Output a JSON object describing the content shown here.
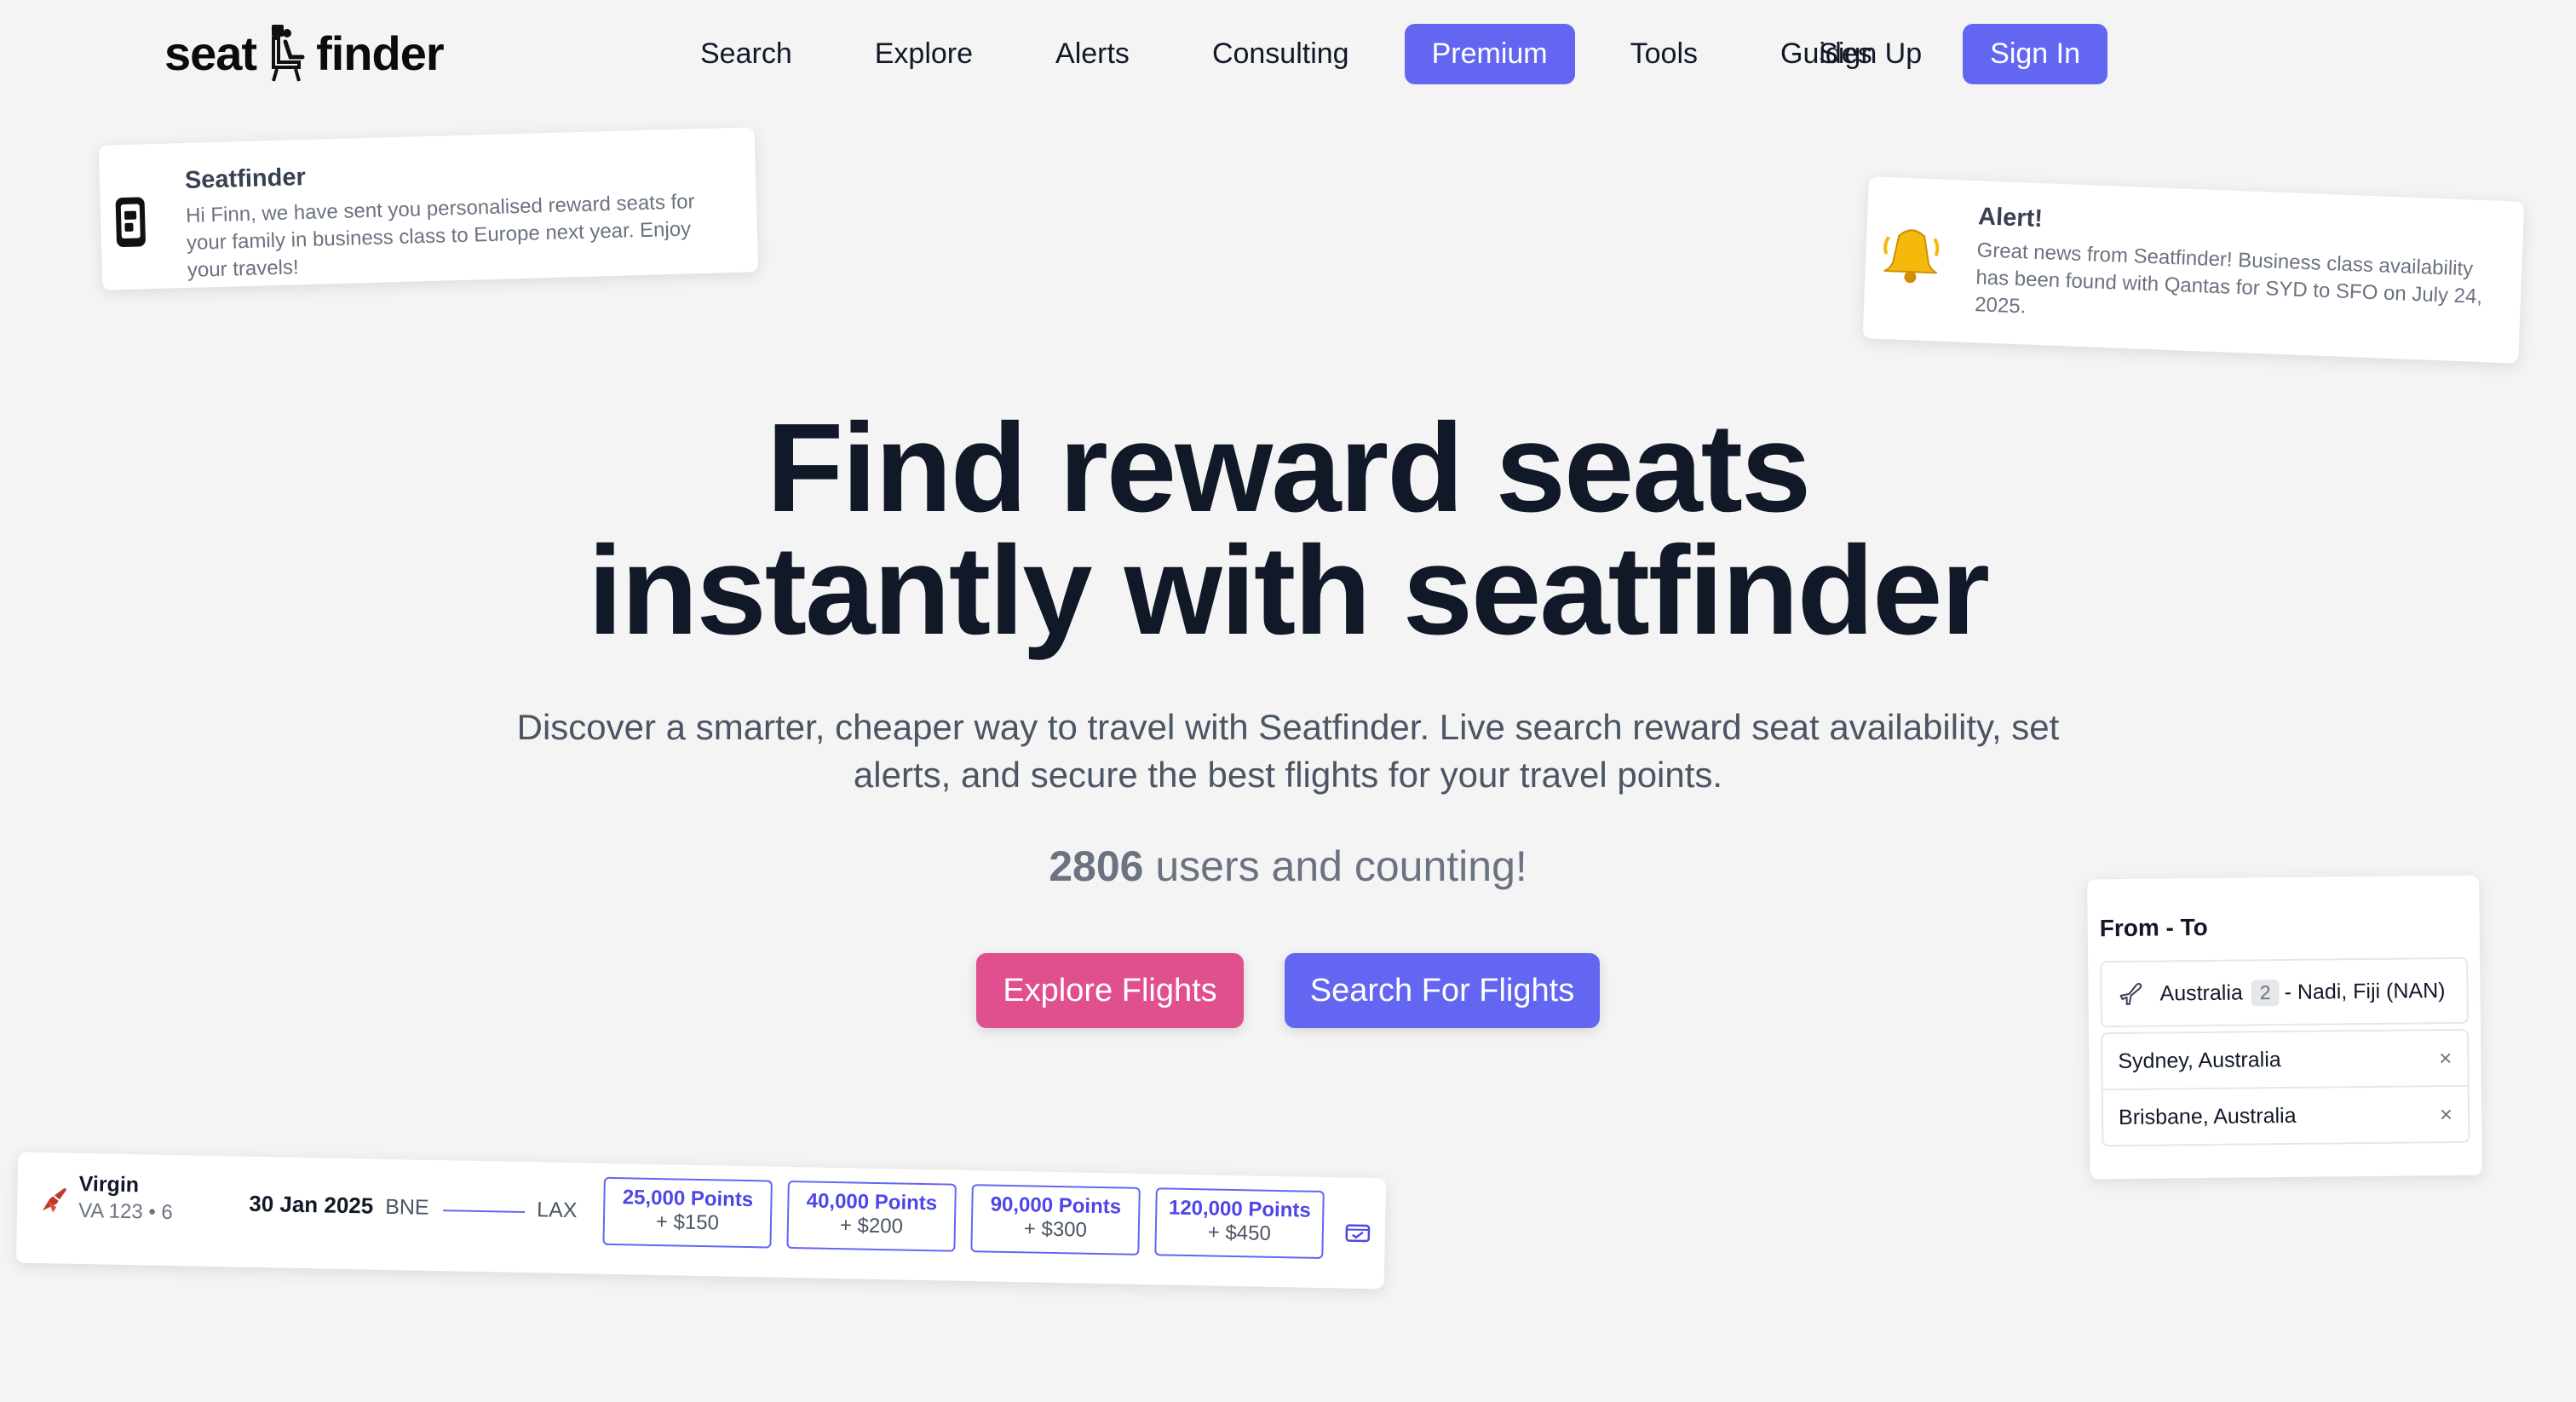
{
  "brand": {
    "name_left": "seat",
    "name_right": "finder"
  },
  "nav": {
    "links": [
      "Search",
      "Explore",
      "Alerts",
      "Consulting",
      "Premium",
      "Tools",
      "Guides"
    ],
    "signup": "Sign Up",
    "signin": "Sign In"
  },
  "notifications": [
    {
      "title": "Seatfinder",
      "message": "Hi Finn, we have sent you personalised reward seats for your family in business class to Europe next year. Enjoy your travels!"
    },
    {
      "title": "Alert!",
      "message": "Great news from Seatfinder! Business class availability has been found with Qantas for SYD to SFO on July 24, 2025."
    }
  ],
  "hero": {
    "title_line1": "Find reward seats",
    "title_line2": "instantly with seatfinder",
    "subtitle": "Discover a smarter, cheaper way to travel with Seatfinder. Live search reward seat availability, set alerts, and secure the best flights for your travel points.",
    "user_count": "2806",
    "user_count_suffix": " users and counting!",
    "explore_button": "Explore Flights",
    "search_button": "Search For Flights"
  },
  "route_picker": {
    "label": "From - To",
    "origin": "Australia",
    "origin_count": "2",
    "destination": "- Nadi, Fiji (NAN)",
    "options": [
      "Sydney, Australia",
      "Brisbane, Australia"
    ],
    "remove_glyph": "×"
  },
  "flight": {
    "airline": "Virgin",
    "code": "VA 123 • 6",
    "date": "30 Jan 2025",
    "origin": "BNE",
    "destination": "LAX",
    "fares": [
      {
        "points": "25,000 Points",
        "fee": "+ $150"
      },
      {
        "points": "40,000 Points",
        "fee": "+ $200"
      },
      {
        "points": "90,000 Points",
        "fee": "+ $300"
      },
      {
        "points": "120,000 Points",
        "fee": "+ $450"
      }
    ]
  },
  "colors": {
    "accent": "#6366f1",
    "pink": "#e0508f",
    "background": "#f4f4f5"
  },
  "icons": {
    "logo": "seat-icon",
    "notif1": "phone-icon",
    "notif2": "bell-icon",
    "route": "plane-icon",
    "airline": "airline-logo-icon",
    "ticket": "ticket-icon"
  }
}
